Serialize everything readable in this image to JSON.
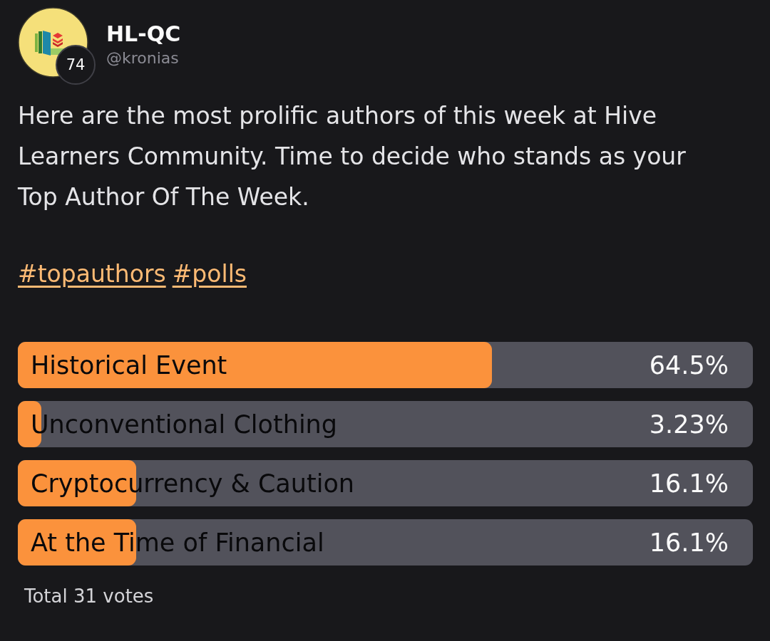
{
  "post": {
    "author": {
      "name": "HL-QC",
      "handle": "@kronias",
      "badge": "74"
    },
    "text": "Here are the most prolific authors of this week at Hive Learners Community. Time to decide who stands as your Top Author Of The Week.",
    "hashtags": [
      "#topauthors",
      "#polls"
    ]
  },
  "poll": {
    "options": [
      {
        "label": "Historical Event",
        "percent": "64.5%",
        "level": 0.645
      },
      {
        "label": "Unconventional Clothing",
        "percent": "3.23%",
        "level": 0.032
      },
      {
        "label": "Cryptocurrency & Caution",
        "percent": "16.1%",
        "level": 0.161
      },
      {
        "label": "At the Time of Financial",
        "percent": "16.1%",
        "level": 0.161
      }
    ],
    "total": "Total 31 votes"
  }
}
